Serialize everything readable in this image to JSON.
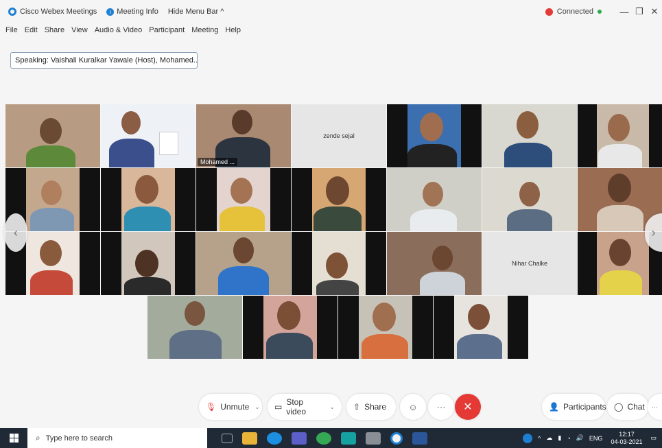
{
  "titlebar": {
    "app_title": "Cisco Webex Meetings",
    "meeting_info": "Meeting Info",
    "hide_menu": "Hide Menu Bar ^",
    "status": "Connected",
    "minimize": "—",
    "restore": "❐",
    "close": "✕"
  },
  "menu": [
    "File",
    "Edit",
    "Share",
    "View",
    "Audio & Video",
    "Participant",
    "Meeting",
    "Help"
  ],
  "speaking": "Speaking: Vaishali Kuralkar Yawale (Host), Mohamed...",
  "tiles": {
    "active_label": "Mohamed ...",
    "name_tile_1": "zende sejal",
    "name_tile_2": "Nihar Chalke"
  },
  "controls": {
    "unmute": "Unmute",
    "stop_video": "Stop video",
    "share": "Share",
    "participants": "Participants",
    "chat": "Chat",
    "more": "···"
  },
  "taskbar": {
    "search_placeholder": "Type here to search",
    "lang": "ENG",
    "time": "12:17",
    "date": "04-03-2021"
  },
  "colors": {
    "accent": "#1e7fd1",
    "end_call": "#e53935",
    "connected": "#2eaa4a",
    "active_outline": "#4fc3f7",
    "taskbar": "#1f2a36"
  }
}
